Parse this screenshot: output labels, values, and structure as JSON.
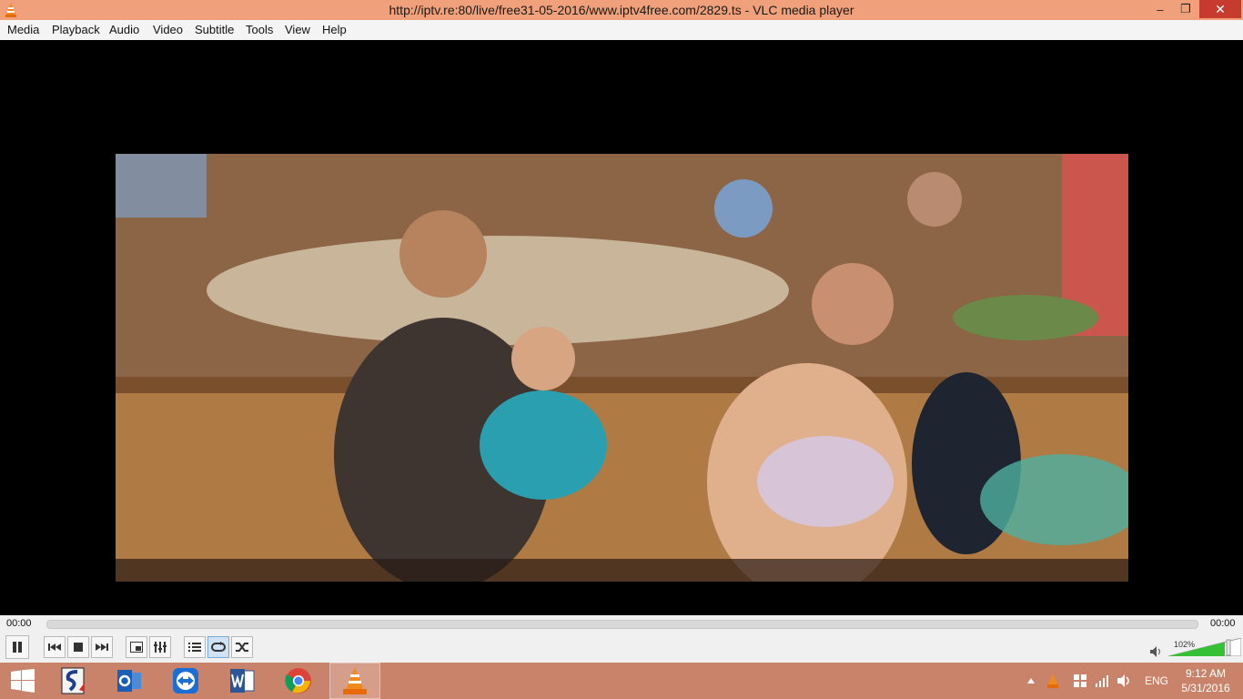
{
  "window": {
    "title": "http://iptv.re:80/live/free31-05-2016/www.iptv4free.com/2829.ts - VLC media player",
    "controls": {
      "minimize": "‒",
      "maximize": "❐",
      "close": "✕"
    }
  },
  "menu": [
    "Media",
    "Playback",
    "Audio",
    "Video",
    "Subtitle",
    "Tools",
    "View",
    "Help"
  ],
  "player": {
    "elapsed": "00:00",
    "total": "00:00",
    "progress": 0,
    "volume_label": "102%",
    "volume_level": 1.02,
    "buttons": {
      "pause": "pause-icon",
      "prev": "previous-icon",
      "stop": "stop-icon",
      "next": "next-icon",
      "fullscreen": "fullscreen-icon",
      "extended": "equalizer-icon",
      "playlist": "playlist-icon",
      "loop": "loop-icon",
      "random": "shuffle-icon"
    },
    "active_buttons": [
      "loop"
    ]
  },
  "taskbar": {
    "apps": [
      "start-icon",
      "scan-app-icon",
      "outlook-icon",
      "teamviewer-icon",
      "word-icon",
      "chrome-icon",
      "vlc-icon"
    ],
    "active_app": "vlc-icon",
    "tray": {
      "language": "ENG",
      "time": "9:12 AM",
      "date": "5/31/2016"
    }
  },
  "colors": {
    "titlebar": "#f0a07a",
    "taskbar": "#c9836a",
    "close": "#c73a2f",
    "accent_volume": "#35c035"
  }
}
